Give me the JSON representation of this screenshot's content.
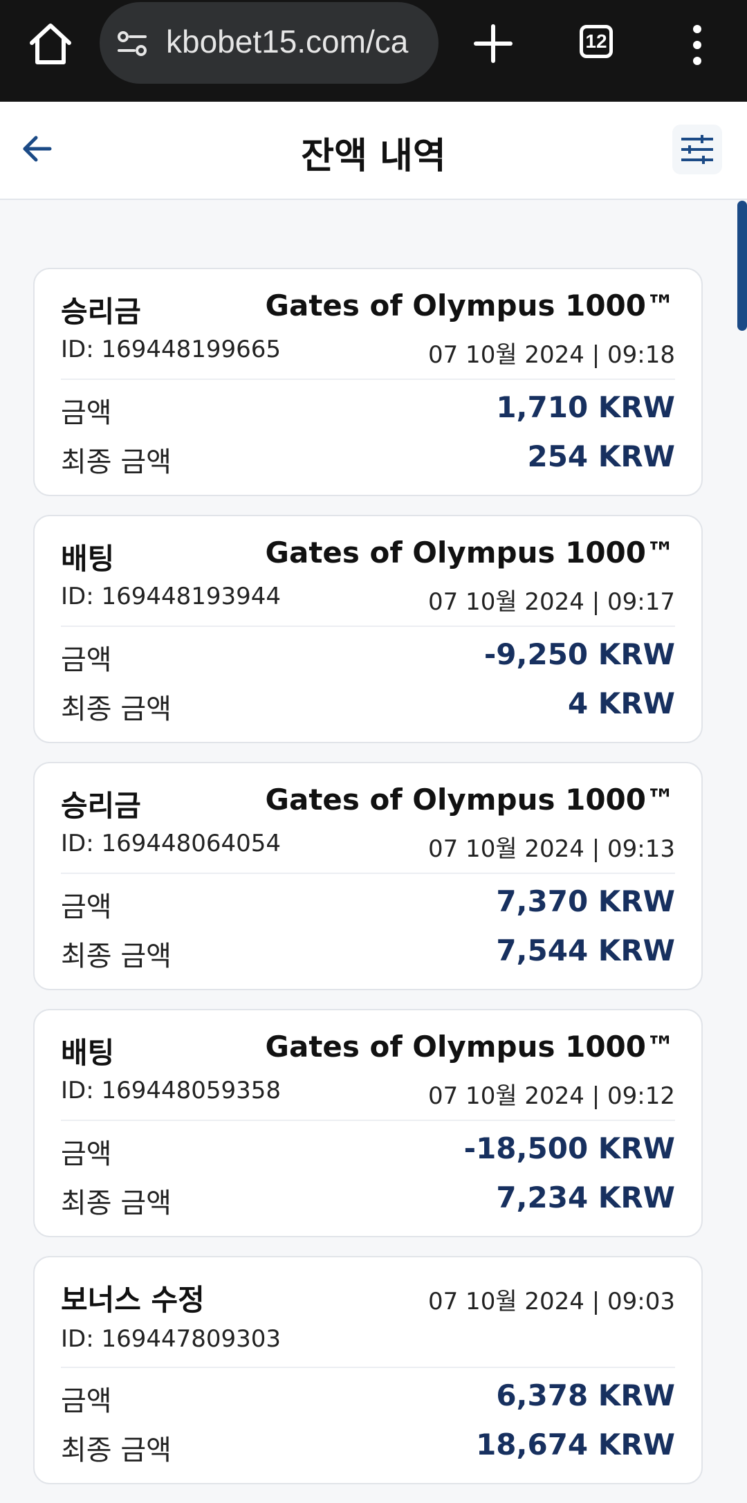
{
  "browser": {
    "url": "kbobet15.com/ca",
    "tab_count": "12"
  },
  "header": {
    "title": "잔액 내역"
  },
  "labels": {
    "amount": "금액",
    "final_amount": "최종 금액"
  },
  "transactions": [
    {
      "type": "승리금",
      "game": "Gates of Olympus 1000™",
      "id": "ID: 169448199665",
      "date": "07 10월 2024 | 09:18",
      "amount": "1,710 KRW",
      "final_amount": "254 KRW"
    },
    {
      "type": "배팅",
      "game": "Gates of Olympus 1000™",
      "id": "ID: 169448193944",
      "date": "07 10월 2024 | 09:17",
      "amount": "-9,250 KRW",
      "final_amount": "4 KRW"
    },
    {
      "type": "승리금",
      "game": "Gates of Olympus 1000™",
      "id": "ID: 169448064054",
      "date": "07 10월 2024 | 09:13",
      "amount": "7,370 KRW",
      "final_amount": "7,544 KRW"
    },
    {
      "type": "배팅",
      "game": "Gates of Olympus 1000™",
      "id": "ID: 169448059358",
      "date": "07 10월 2024 | 09:12",
      "amount": "-18,500 KRW",
      "final_amount": "7,234 KRW"
    },
    {
      "type": "보너스 수정",
      "game": "",
      "id": "ID: 169447809303",
      "date": "07 10월 2024 | 09:03",
      "amount": "6,378 KRW",
      "final_amount": "18,674 KRW"
    }
  ],
  "colors": {
    "accent": "#1b4a86",
    "amount_text": "#17305f",
    "chrome_bg": "#141414"
  }
}
